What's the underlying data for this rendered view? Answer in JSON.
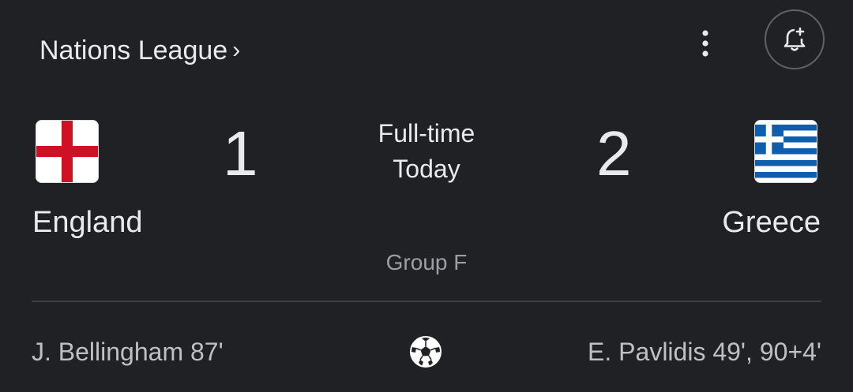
{
  "header": {
    "competition": "Nations League",
    "chevron": "›",
    "more_icon": "more-vert-icon",
    "alert_icon": "add-alert-icon"
  },
  "match": {
    "status_line1": "Full-time",
    "status_line2": "Today",
    "group": "Group F",
    "home": {
      "name": "England",
      "score": "1",
      "flag_icon": "england-flag-icon",
      "scorers": "J. Bellingham 87'"
    },
    "away": {
      "name": "Greece",
      "score": "2",
      "flag_icon": "greece-flag-icon",
      "scorers": "E. Pavlidis 49', 90+4'"
    },
    "goal_icon": "soccer-ball-icon"
  },
  "colors": {
    "background": "#202124",
    "text_primary": "#e8eaed",
    "text_secondary": "#9aa0a6",
    "divider": "#3c4043",
    "england_red": "#ce1124",
    "greece_blue": "#0d5eaf"
  }
}
